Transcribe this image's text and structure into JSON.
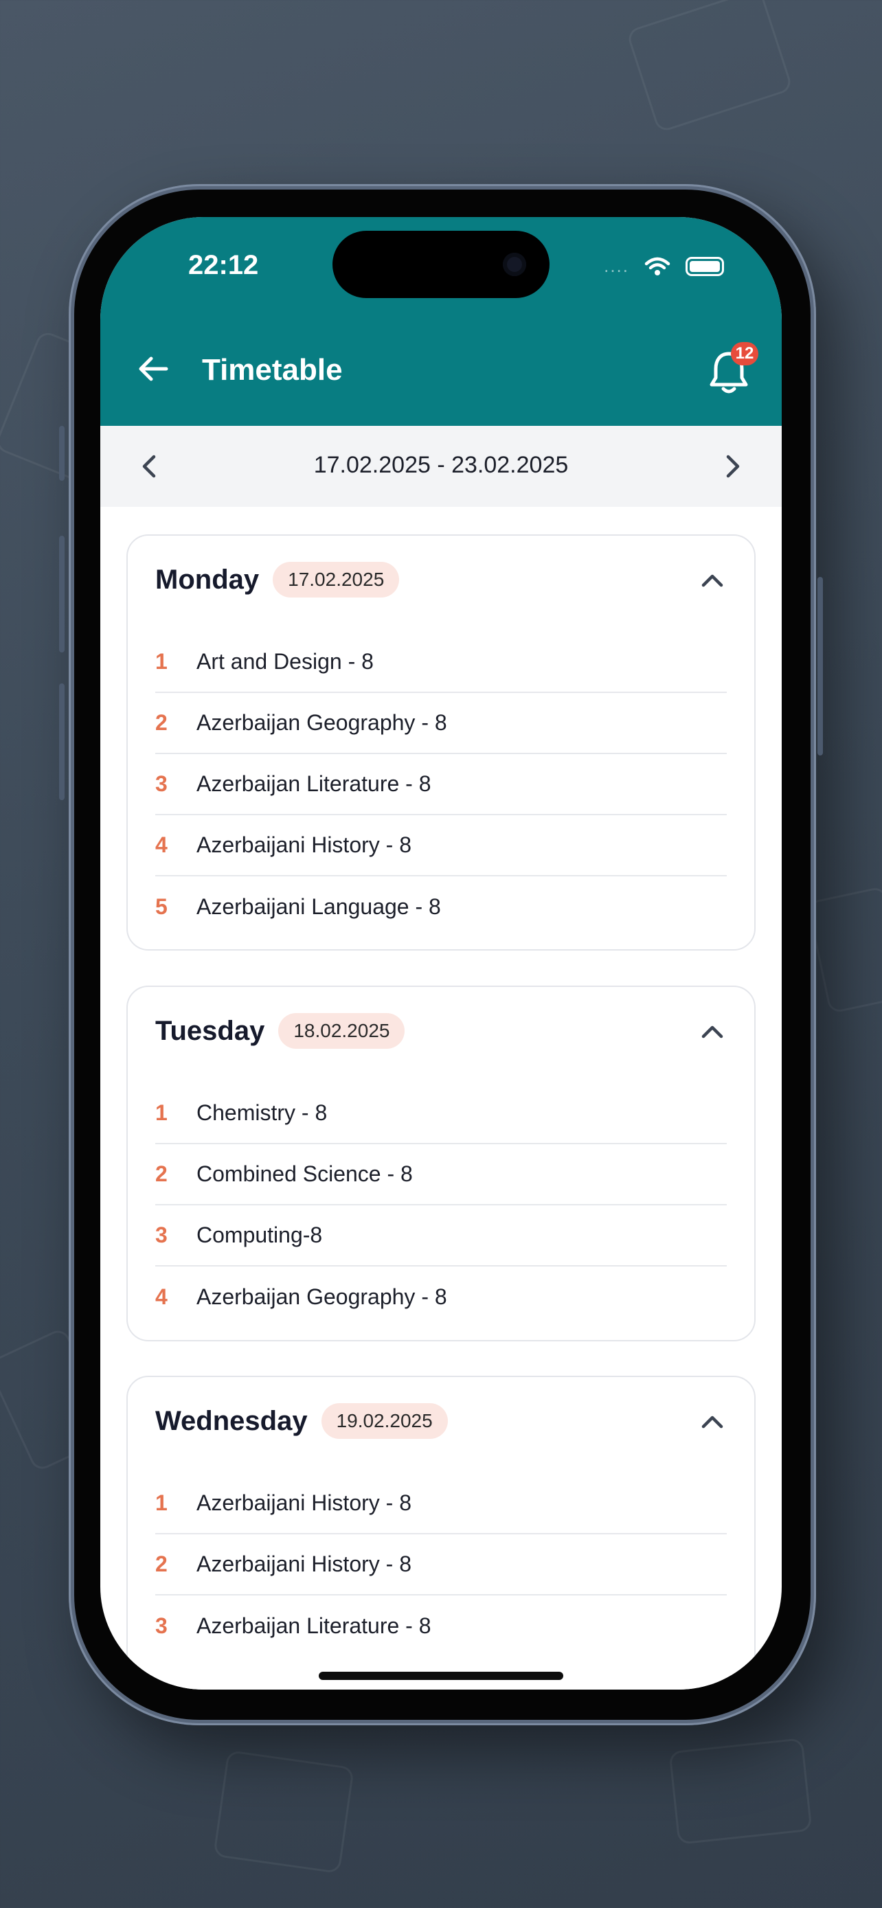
{
  "status_bar": {
    "time": "22:12",
    "signal": "....",
    "wifi_icon": "wifi-icon",
    "battery_icon": "battery-icon"
  },
  "header": {
    "title": "Timetable",
    "back_icon": "arrow-left-icon",
    "bell_icon": "bell-icon",
    "notification_count": "12",
    "background_color": "#087d82",
    "badge_color": "#e74c3c"
  },
  "week": {
    "range": "17.02.2025 - 23.02.2025",
    "prev_icon": "chevron-left-icon",
    "next_icon": "chevron-right-icon"
  },
  "days": [
    {
      "name": "Monday",
      "date": "17.02.2025",
      "lessons": [
        {
          "num": "1",
          "subject": "Art and Design - 8"
        },
        {
          "num": "2",
          "subject": "Azerbaijan Geography - 8"
        },
        {
          "num": "3",
          "subject": "Azerbaijan Literature - 8"
        },
        {
          "num": "4",
          "subject": "Azerbaijani History - 8"
        },
        {
          "num": "5",
          "subject": "Azerbaijani Language - 8"
        }
      ]
    },
    {
      "name": "Tuesday",
      "date": "18.02.2025",
      "lessons": [
        {
          "num": "1",
          "subject": "Chemistry - 8"
        },
        {
          "num": "2",
          "subject": "Combined Science - 8"
        },
        {
          "num": "3",
          "subject": "Computing-8"
        },
        {
          "num": "4",
          "subject": "Azerbaijan Geography - 8"
        }
      ]
    },
    {
      "name": "Wednesday",
      "date": "19.02.2025",
      "lessons": [
        {
          "num": "1",
          "subject": "Azerbaijani History - 8"
        },
        {
          "num": "2",
          "subject": "Azerbaijani History - 8"
        },
        {
          "num": "3",
          "subject": "Azerbaijan Literature - 8"
        }
      ]
    }
  ],
  "theme": {
    "accent": "#e5734f",
    "date_pill": "#fbe6e1"
  }
}
